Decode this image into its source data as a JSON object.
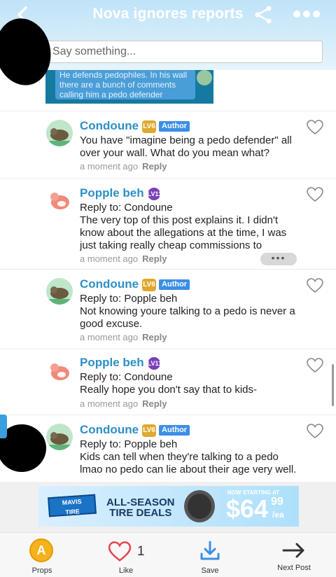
{
  "header": {
    "title": "Nova ignores reports",
    "say_placeholder": "Say something..."
  },
  "quoted": {
    "text": "He defends pedophiles. In his wall there are a bunch of comments calling him a pedo defender"
  },
  "comments": [
    {
      "name": "Condoune",
      "level": "LV6",
      "author_badge": "Author",
      "reply_to": "",
      "body": "You have \"imagine being a pedo defender\" all over your wall. What do you mean what?",
      "time": "a moment ago",
      "reply_label": "Reply"
    },
    {
      "name": "Popple beh",
      "level": "LV11",
      "author_badge": "",
      "reply_to": "Reply to: Condoune",
      "body": "The very top of this post explains it. I didn't know about the allegations at the time, I was just taking really cheap commissions to",
      "time": "a moment ago",
      "reply_label": "Reply",
      "more": "•••"
    },
    {
      "name": "Condoune",
      "level": "LV6",
      "author_badge": "Author",
      "reply_to": "Reply to: Popple beh",
      "body": "Not knowing youre talking to a pedo is never a good excuse.",
      "time": "a moment ago",
      "reply_label": "Reply"
    },
    {
      "name": "Popple beh",
      "level": "LV11",
      "author_badge": "",
      "reply_to": "Reply to: Condoune",
      "body": "Really hope you don't say that to kids-",
      "time": "a moment ago",
      "reply_label": "Reply"
    },
    {
      "name": "Condoune",
      "level": "LV6",
      "author_badge": "Author",
      "reply_to": "Reply to: Popple beh",
      "body": "Kids can tell when they're talking to a pedo lmao no pedo can lie about their age very well.",
      "time": "",
      "reply_label": ""
    }
  ],
  "ad": {
    "brand_line1": "MAVIS",
    "brand_line2": "TIRE",
    "headline_line1": "ALL-SEASON",
    "headline_line2": "TIRE DEALS",
    "now_starting": "NOW STARTING AT",
    "price_dollars": "$64",
    "price_cents": "99",
    "price_unit": "/ea"
  },
  "bottom_bar": {
    "props_label": "Props",
    "like_label": "Like",
    "like_count": "1",
    "save_label": "Save",
    "next_label": "Next Post"
  },
  "colors": {
    "username": "#2d8fc6",
    "author_badge": "#3b8ee6",
    "level_gold": "#e0a82e",
    "level_purple": "#7b3fb8",
    "like_heart": "#e8424f",
    "save_icon": "#3b8ee6"
  },
  "icons": [
    "back-icon",
    "share-icon",
    "more-icon",
    "heart-outline-icon",
    "props-coin-icon",
    "like-heart-icon",
    "download-save-icon",
    "arrow-right-icon"
  ]
}
